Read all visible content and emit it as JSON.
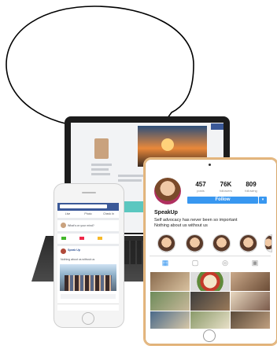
{
  "bubble": {
    "text": ""
  },
  "laptop": {
    "label": ""
  },
  "instagram": {
    "stats": [
      {
        "value": "457",
        "label": "posts"
      },
      {
        "value": "76K",
        "label": "followers"
      },
      {
        "value": "809",
        "label": "following"
      }
    ],
    "follow_label": "Follow",
    "follow_dropdown": "▾",
    "name": "SpeakUp",
    "bio": [
      "Self advocacy has never been so important",
      "Nothing about us without us"
    ],
    "tabs": [
      "grid-icon",
      "tv-icon",
      "target-icon",
      "tag-icon"
    ]
  },
  "facebook": {
    "tabs": [
      "Live",
      "Photo",
      "Check In"
    ],
    "composer_placeholder": "What's on your mind?",
    "post_author": "Speak Up",
    "post_text": "Nothing about us without us"
  },
  "colors": {
    "instagram_blue": "#3897f0",
    "facebook_blue": "#3b5998",
    "tablet_gold": "#e6b982"
  }
}
